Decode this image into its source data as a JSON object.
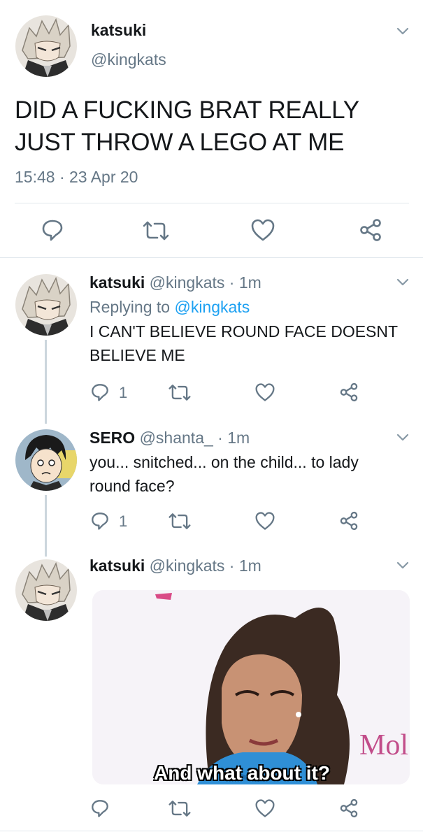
{
  "main_tweet": {
    "display_name": "katsuki",
    "handle": "@kingkats",
    "text_line1": "DID A FUCKING BRAT REALLY",
    "text_line2": "JUST THROW A LEGO AT ME",
    "timestamp": "15:48 · 23 Apr 20"
  },
  "replies": [
    {
      "display_name": "katsuki",
      "handle_time": "@kingkats · 1m",
      "replying_prefix": "Replying to ",
      "replying_handle": "@kingkats",
      "text_line1": "I CAN'T BELIEVE ROUND FACE DOESNT",
      "text_line2": "BELIEVE ME",
      "reply_count": "1"
    },
    {
      "display_name": "SERO",
      "handle_time": "@shanta_ · 1m",
      "text_line1": "you... snitched... on the child... to lady",
      "text_line2": "round face?",
      "reply_count": "1"
    },
    {
      "display_name": "katsuki",
      "handle_time": "@kingkats · 1m",
      "media_caption": "And what about it?",
      "media_sign": "Mol"
    }
  ],
  "colors": {
    "accent": "#1da1f2",
    "muted": "#657786",
    "divider": "#e1e8ed"
  },
  "icons": [
    "chevron-down-icon",
    "reply-icon",
    "retweet-icon",
    "like-icon",
    "share-icon"
  ]
}
